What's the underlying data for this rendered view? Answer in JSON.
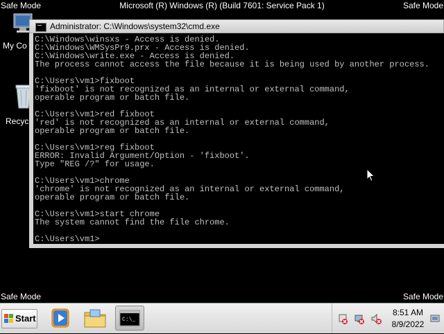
{
  "desktop": {
    "safe_mode_label": "Safe Mode",
    "os_title": "Microsoft (R) Windows (R) (Build 7601: Service Pack 1)",
    "icons": [
      {
        "label": "My Co",
        "icon": "computer-icon"
      },
      {
        "label": "Recycl",
        "icon": "recycle-bin-icon"
      }
    ]
  },
  "cmd_window": {
    "title": "Administrator: C:\\Windows\\system32\\cmd.exe",
    "lines": [
      "C:\\Windows\\winsxs - Access is denied.",
      "C:\\Windows\\WMSysPr9.prx - Access is denied.",
      "C:\\Windows\\write.exe - Access is denied.",
      "The process cannot access the file because it is being used by another process.",
      "",
      "C:\\Users\\vm1>fixboot",
      "'fixboot' is not recognized as an internal or external command,",
      "operable program or batch file.",
      "",
      "C:\\Users\\vm1>red fixboot",
      "'red' is not recognized as an internal or external command,",
      "operable program or batch file.",
      "",
      "C:\\Users\\vm1>reg fixboot",
      "ERROR: Invalid Argument/Option - 'fixboot'.",
      "Type \"REG /?\" for usage.",
      "",
      "C:\\Users\\vm1>chrome",
      "'chrome' is not recognized as an internal or external command,",
      "operable program or batch file.",
      "",
      "C:\\Users\\vm1>start chrome",
      "The system cannot find the file chrome.",
      "",
      "C:\\Users\\vm1>"
    ]
  },
  "taskbar": {
    "start_label": "Start",
    "pinned": [
      "media-player-icon",
      "windows-explorer-icon",
      "cmd-icon"
    ],
    "tray_icons": [
      "action-center-icon",
      "network-icon",
      "volume-icon"
    ],
    "clock_time": "8:51 AM",
    "clock_date": "8/9/2022"
  }
}
